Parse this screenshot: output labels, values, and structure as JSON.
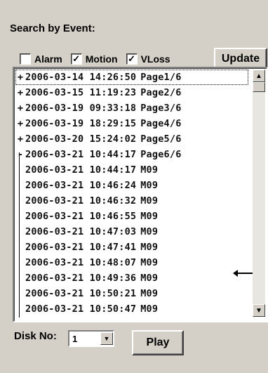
{
  "title": "Search by Event:",
  "filters": [
    {
      "label": "Alarm",
      "checked": false
    },
    {
      "label": "Motion",
      "checked": true
    },
    {
      "label": "VLoss",
      "checked": true
    }
  ],
  "update_label": "Update",
  "rows": [
    {
      "prefix": "+",
      "text": "2006-03-14 14:26:50",
      "tag": "Page1/6"
    },
    {
      "prefix": "+",
      "text": "2006-03-15 11:19:23",
      "tag": "Page2/6"
    },
    {
      "prefix": "+",
      "text": "2006-03-19 09:33:18",
      "tag": "Page3/6"
    },
    {
      "prefix": "+",
      "text": "2006-03-19 18:29:15",
      "tag": "Page4/6"
    },
    {
      "prefix": "+",
      "text": "2006-03-20 15:24:02",
      "tag": "Page5/6"
    },
    {
      "prefix": "-",
      "text": "2006-03-21 10:44:17",
      "tag": "Page6/6"
    },
    {
      "prefix": "",
      "text": "2006-03-21 10:44:17",
      "tag": "M09"
    },
    {
      "prefix": "",
      "text": "2006-03-21 10:46:24",
      "tag": "M09"
    },
    {
      "prefix": "",
      "text": "2006-03-21 10:46:32",
      "tag": "M09"
    },
    {
      "prefix": "",
      "text": "2006-03-21 10:46:55",
      "tag": "M09"
    },
    {
      "prefix": "",
      "text": "2006-03-21 10:47:03",
      "tag": "M09"
    },
    {
      "prefix": "",
      "text": "2006-03-21 10:47:41",
      "tag": "M09"
    },
    {
      "prefix": "",
      "text": "2006-03-21 10:48:07",
      "tag": "M09"
    },
    {
      "prefix": "",
      "text": "2006-03-21 10:49:36",
      "tag": "M09"
    },
    {
      "prefix": "",
      "text": "2006-03-21 10:50:21",
      "tag": "M09"
    },
    {
      "prefix": "",
      "text": "2006-03-21 10:50:47",
      "tag": "M09"
    }
  ],
  "disk_label": "Disk No:",
  "disk_value": "1",
  "play_label": "Play",
  "icons": {
    "scroll_up": "up-arrow-icon",
    "scroll_down": "down-arrow-icon",
    "dropdown": "dropdown-arrow-icon"
  }
}
